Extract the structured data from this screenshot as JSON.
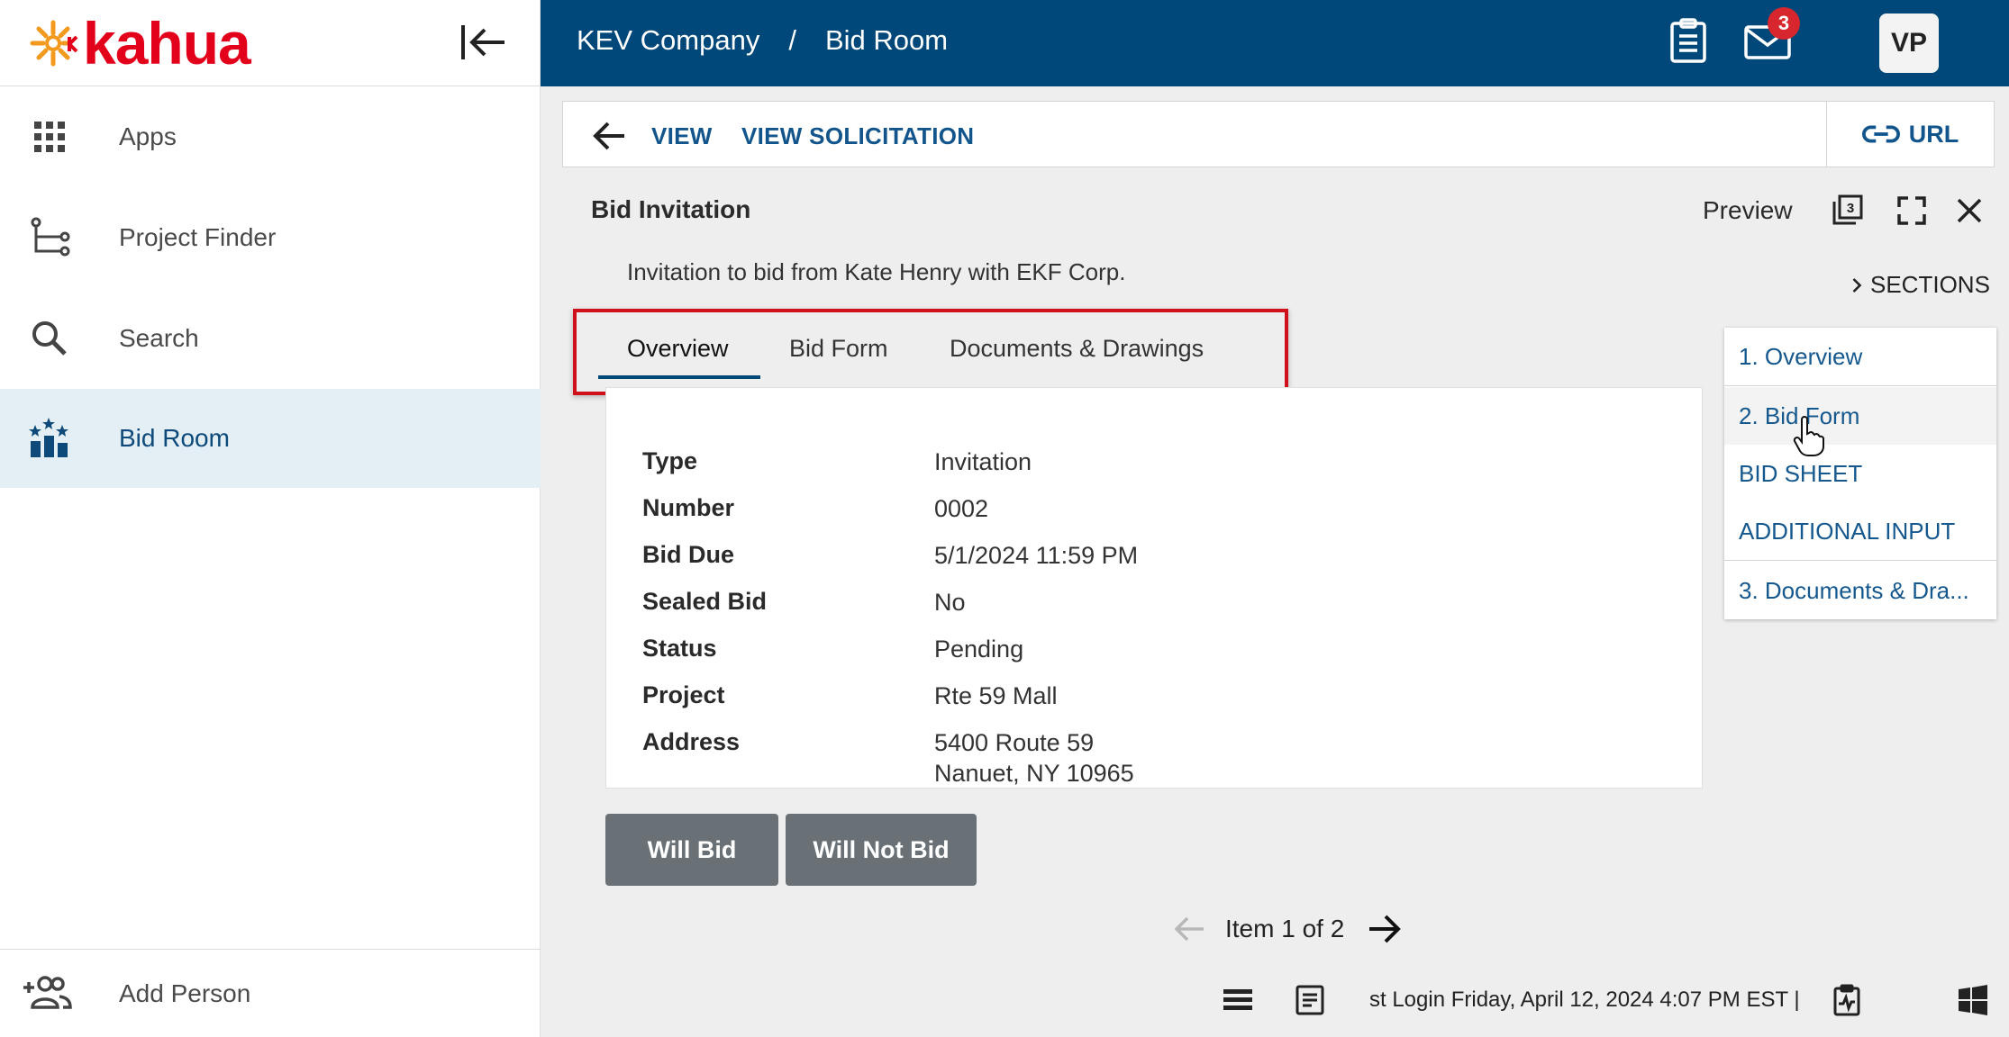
{
  "app": {
    "brand": "kahua"
  },
  "sidebar": {
    "items": [
      {
        "label": "Apps",
        "icon": "apps-grid-icon"
      },
      {
        "label": "Project Finder",
        "icon": "project-tree-icon"
      },
      {
        "label": "Search",
        "icon": "search-icon"
      },
      {
        "label": "Bid Room",
        "icon": "bid-room-icon",
        "active": true
      }
    ],
    "footer": {
      "label": "Add Person",
      "icon": "add-person-icon"
    }
  },
  "header": {
    "breadcrumb": [
      "KEV Company",
      "Bid Room"
    ],
    "separator": "/",
    "mail_badge": "3",
    "avatar": "VP"
  },
  "command_bar": {
    "links": [
      "VIEW",
      "VIEW SOLICITATION"
    ],
    "url_label": "URL"
  },
  "panel": {
    "title": "Bid Invitation",
    "preview_label": "Preview",
    "subtitle": "Invitation to bid from Kate Henry with EKF Corp.",
    "sections_label": "SECTIONS"
  },
  "tabs": [
    {
      "label": "Overview",
      "active": true
    },
    {
      "label": "Bid Form"
    },
    {
      "label": "Documents & Drawings"
    }
  ],
  "details": [
    {
      "label": "Type",
      "value": "Invitation"
    },
    {
      "label": "Number",
      "value": "0002"
    },
    {
      "label": "Bid Due",
      "value": "5/1/2024 11:59 PM"
    },
    {
      "label": "Sealed Bid",
      "value": "No"
    },
    {
      "label": "Status",
      "value": "Pending"
    },
    {
      "label": "Project",
      "value": "Rte 59 Mall"
    },
    {
      "label": "Address",
      "value": "5400 Route 59",
      "value2": "Nanuet, NY  10965"
    }
  ],
  "actions": {
    "will_bid": "Will Bid",
    "will_not_bid": "Will Not Bid"
  },
  "pager": {
    "text": "Item 1 of 2"
  },
  "sections": [
    "1. Overview",
    "2. Bid Form",
    "BID SHEET",
    "ADDITIONAL INPUT",
    "3. Documents & Dra..."
  ],
  "status_bar": {
    "text": "st Login Friday, April 12, 2024 4:07 PM EST  |"
  },
  "colors": {
    "header": "#00487a",
    "brand": "#e2001a",
    "accent": "#12558c",
    "highlight": "#d0111b"
  }
}
